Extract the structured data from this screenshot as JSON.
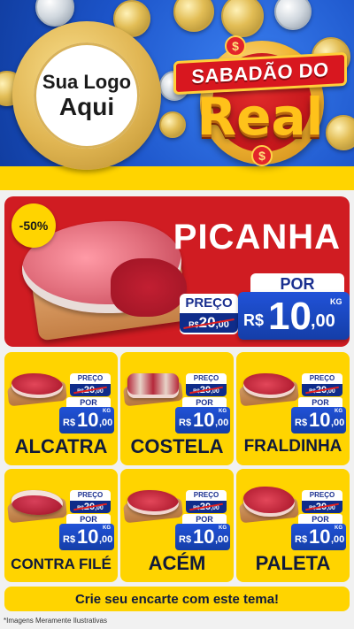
{
  "header": {
    "logo_line1": "Sua Logo",
    "logo_line2": "Aqui",
    "title_top": "SABADÃO DO",
    "title_big": "Real",
    "dollar_symbol": "$"
  },
  "featured": {
    "discount": "-50%",
    "name": "PICANHA",
    "old_label": "PREÇO",
    "old_currency": "R$",
    "old_int": "20",
    "old_dec": ",00",
    "new_label": "POR",
    "new_currency": "R$",
    "new_int": "10",
    "new_dec": ",00",
    "unit": "KG"
  },
  "products": [
    {
      "name": "ALCATRA",
      "old_label": "PREÇO",
      "old_currency": "R$",
      "old_int": "20",
      "old_dec": ",00",
      "new_label": "POR",
      "new_currency": "R$",
      "new_int": "10",
      "new_dec": ",00",
      "unit": "KG"
    },
    {
      "name": "COSTELA",
      "old_label": "PREÇO",
      "old_currency": "R$",
      "old_int": "20",
      "old_dec": ",00",
      "new_label": "POR",
      "new_currency": "R$",
      "new_int": "10",
      "new_dec": ",00",
      "unit": "KG"
    },
    {
      "name": "FRALDINHA",
      "old_label": "PREÇO",
      "old_currency": "R$",
      "old_int": "20",
      "old_dec": ",00",
      "new_label": "POR",
      "new_currency": "R$",
      "new_int": "10",
      "new_dec": ",00",
      "unit": "KG"
    },
    {
      "name": "CONTRA FILÉ",
      "old_label": "PREÇO",
      "old_currency": "R$",
      "old_int": "20",
      "old_dec": ",00",
      "new_label": "POR",
      "new_currency": "R$",
      "new_int": "10",
      "new_dec": ",00",
      "unit": "KG"
    },
    {
      "name": "ACÉM",
      "old_label": "PREÇO",
      "old_currency": "R$",
      "old_int": "20",
      "old_dec": ",00",
      "new_label": "POR",
      "new_currency": "R$",
      "new_int": "10",
      "new_dec": ",00",
      "unit": "KG"
    },
    {
      "name": "PALETA",
      "old_label": "PREÇO",
      "old_currency": "R$",
      "old_int": "20",
      "old_dec": ",00",
      "new_label": "POR",
      "new_currency": "R$",
      "new_int": "10",
      "new_dec": ",00",
      "unit": "KG"
    }
  ],
  "footer": {
    "cta": "Crie seu encarte com este tema!",
    "disclaimer": "*Imagens Meramente Ilustrativas"
  },
  "colors": {
    "header_blue": "#1c54c9",
    "featured_red": "#d01c22",
    "card_yellow": "#ffd400",
    "price_blue": "#143ea8",
    "title_gold": "#ffc21a"
  }
}
